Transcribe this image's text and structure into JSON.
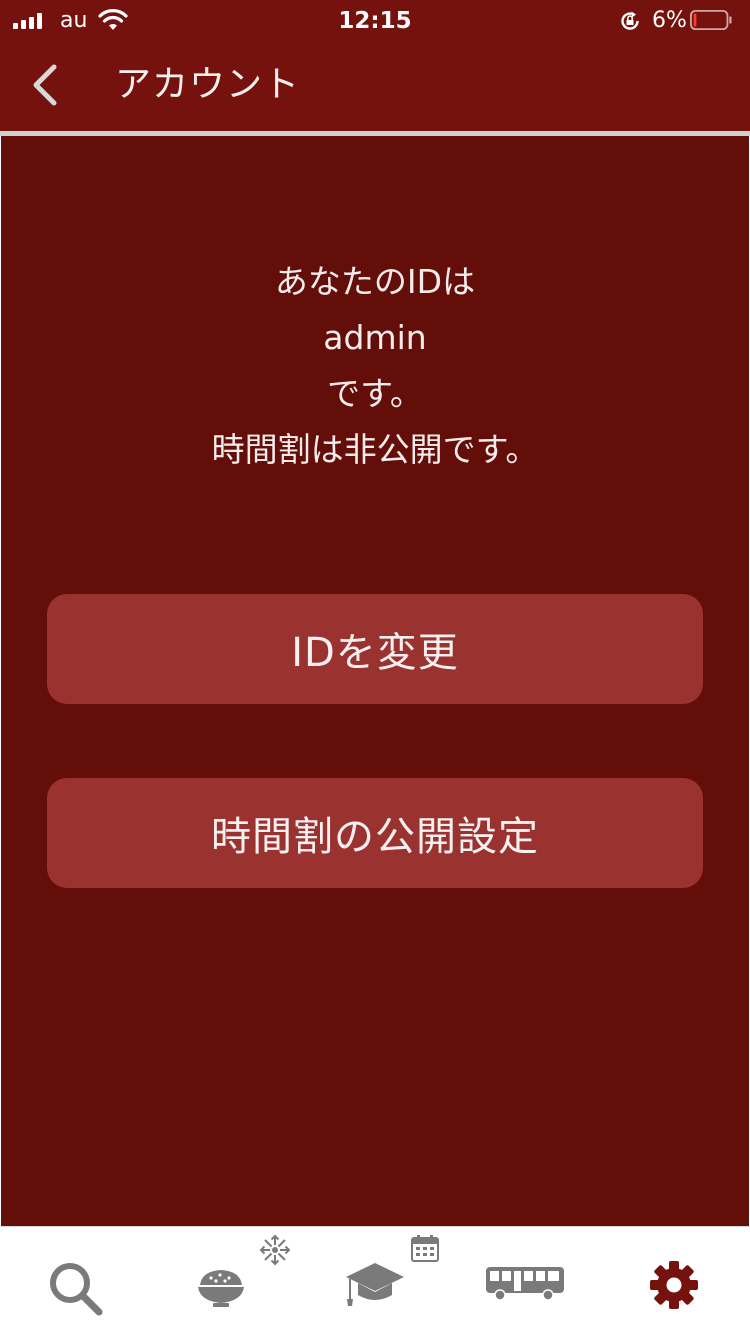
{
  "status_bar": {
    "carrier": "au",
    "time": "12:15",
    "battery_percent": "6%"
  },
  "nav": {
    "title": "アカウント",
    "back_icon": "chevron-left-icon"
  },
  "message": {
    "line1": "あなたのIDは",
    "line2": "admin",
    "line3": "です。",
    "line4": "時間割は非公開です。"
  },
  "buttons": {
    "change_id": "IDを変更",
    "publish_settings": "時間割の公開設定"
  },
  "tabs": [
    {
      "icon": "search-icon",
      "active": false
    },
    {
      "icon": "rice-bowl-icon",
      "active": false
    },
    {
      "icon": "graduation-cap-icon",
      "active": false
    },
    {
      "icon": "bus-icon",
      "active": false
    },
    {
      "icon": "gear-icon",
      "active": true
    }
  ],
  "colors": {
    "header": "#76120e",
    "background": "#640e0a",
    "button": "#9a3230",
    "tab_inactive": "#7a7a7a",
    "tab_active": "#76120e"
  }
}
